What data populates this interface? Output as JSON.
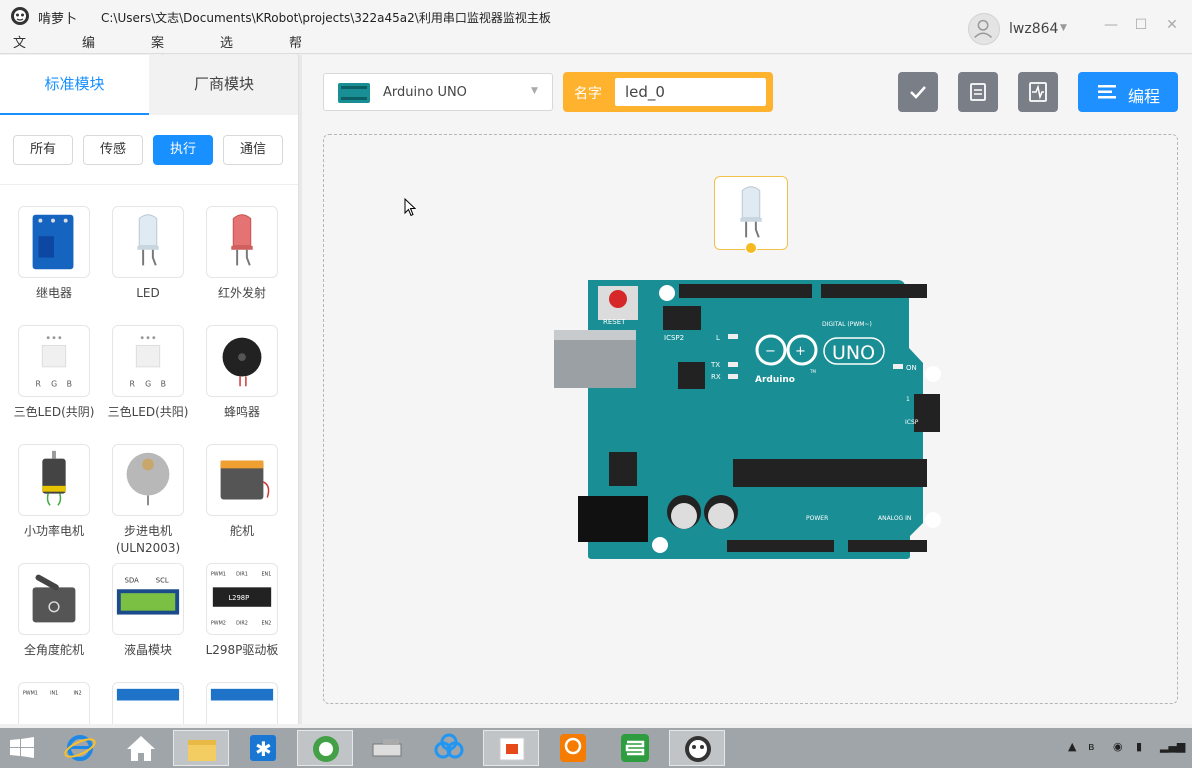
{
  "window": {
    "app_name": "啃萝卜",
    "path": "C:\\Users\\文志\\Documents\\KRobot\\projects\\322a45a2\\利用串口监视器监视主板"
  },
  "menu": [
    {
      "label": "文件"
    },
    {
      "label": "编辑"
    },
    {
      "label": "案例"
    },
    {
      "label": "选项"
    },
    {
      "label": "帮助"
    }
  ],
  "user": {
    "name": "lwz864"
  },
  "tabs": {
    "standard": "标准模块",
    "vendor": "厂商模块"
  },
  "filters": [
    {
      "label": "所有",
      "active": false
    },
    {
      "label": "传感",
      "active": false
    },
    {
      "label": "执行",
      "active": true
    },
    {
      "label": "通信",
      "active": false
    }
  ],
  "modules": [
    {
      "label": "继电器",
      "icon": "relay-icon"
    },
    {
      "label": "LED",
      "icon": "led-white-icon"
    },
    {
      "label": "红外发射",
      "icon": "ir-led-icon"
    },
    {
      "label": "三色LED(共阴)",
      "icon": "rgb-led-icon"
    },
    {
      "label": "三色LED(共阳)",
      "icon": "rgb-led-icon"
    },
    {
      "label": "蜂鸣器",
      "icon": "buzzer-icon"
    },
    {
      "label": "小功率电机",
      "icon": "motor-icon"
    },
    {
      "label": "步进电机(ULN2003)",
      "icon": "stepper-icon"
    },
    {
      "label": "舵机",
      "icon": "servo-icon"
    },
    {
      "label": "全角度舵机",
      "icon": "servo360-icon"
    },
    {
      "label": "液晶模块",
      "icon": "lcd-icon"
    },
    {
      "label": "L298P驱动板",
      "icon": "l298p-icon"
    }
  ],
  "module_thumb_text": {
    "rgb": [
      "R",
      "G",
      "B"
    ],
    "lcd": [
      "SDA",
      "SCL"
    ],
    "l298p_top": [
      "PWM1",
      "DIR1",
      "EN1"
    ],
    "l298p_chip": "L298P",
    "l298p_bottom": [
      "PWM2",
      "DIR2",
      "EN2"
    ],
    "partial": [
      "PWM1",
      "IN1",
      "IN2"
    ]
  },
  "board": {
    "select_value": "Arduino UNO",
    "name_label": "名字",
    "name_value": "led_0",
    "program_label": "编程"
  },
  "board_text": {
    "reset": "RESET",
    "icsp2": "ICSP2",
    "l": "L",
    "tx": "TX",
    "rx": "RX",
    "on": "ON",
    "brand": "Arduino",
    "uno": "UNO",
    "tm": "TM",
    "digital": "DIGITAL (PWM~)",
    "power": "POWER",
    "analog": "ANALOG IN",
    "icsp": "ICSP",
    "one": "1"
  },
  "colors": {
    "accent": "#1890ff",
    "name_box": "#ffb22e",
    "board": "#1a8e95"
  }
}
